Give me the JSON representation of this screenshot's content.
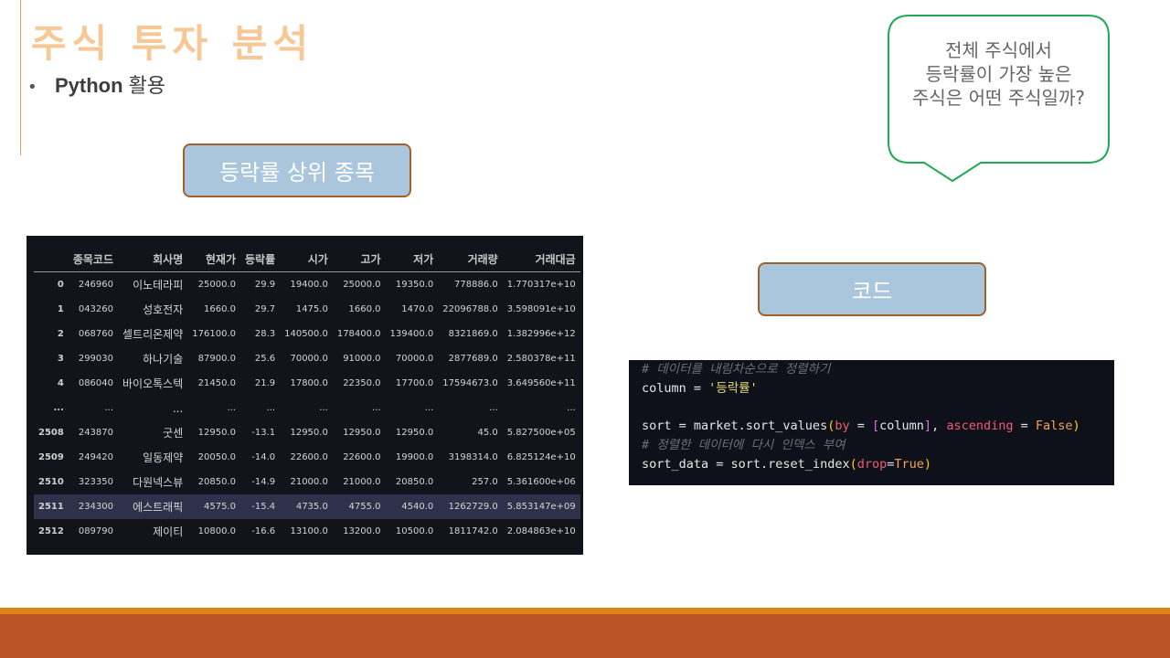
{
  "title": "주식 투자 분석",
  "bullet": {
    "marker": "•",
    "bold": "Python",
    "text": "활용"
  },
  "labels": {
    "top_stocks": "등락률 상위 종목",
    "code": "코드"
  },
  "bubble": {
    "lines": [
      "전체 주식에서",
      "등락률이 가장 높은",
      "주식은 어떤 주식일까?"
    ]
  },
  "table": {
    "columns": [
      "",
      "종목코드",
      "회사명",
      "현재가",
      "등락률",
      "시가",
      "고가",
      "저가",
      "거래량",
      "거래대금"
    ],
    "rows": [
      [
        "0",
        "246960",
        "이노테라피",
        "25000.0",
        "29.9",
        "19400.0",
        "25000.0",
        "19350.0",
        "778886.0",
        "1.770317e+10"
      ],
      [
        "1",
        "043260",
        "성호전자",
        "1660.0",
        "29.7",
        "1475.0",
        "1660.0",
        "1470.0",
        "22096788.0",
        "3.598091e+10"
      ],
      [
        "2",
        "068760",
        "셀트리온제약",
        "176100.0",
        "28.3",
        "140500.0",
        "178400.0",
        "139400.0",
        "8321869.0",
        "1.382996e+12"
      ],
      [
        "3",
        "299030",
        "하나기술",
        "87900.0",
        "25.6",
        "70000.0",
        "91000.0",
        "70000.0",
        "2877689.0",
        "2.580378e+11"
      ],
      [
        "4",
        "086040",
        "바이오톡스텍",
        "21450.0",
        "21.9",
        "17800.0",
        "22350.0",
        "17700.0",
        "17594673.0",
        "3.649560e+11"
      ],
      [
        "...",
        "...",
        "...",
        "...",
        "...",
        "...",
        "...",
        "...",
        "...",
        "..."
      ],
      [
        "2508",
        "243870",
        "굿센",
        "12950.0",
        "-13.1",
        "12950.0",
        "12950.0",
        "12950.0",
        "45.0",
        "5.827500e+05"
      ],
      [
        "2509",
        "249420",
        "일동제약",
        "20050.0",
        "-14.0",
        "22600.0",
        "22600.0",
        "19900.0",
        "3198314.0",
        "6.825124e+10"
      ],
      [
        "2510",
        "323350",
        "다원넥스뷰",
        "20850.0",
        "-14.9",
        "21000.0",
        "21000.0",
        "20850.0",
        "257.0",
        "5.361600e+06"
      ],
      [
        "2511",
        "234300",
        "에스트래픽",
        "4575.0",
        "-15.4",
        "4735.0",
        "4755.0",
        "4540.0",
        "1262729.0",
        "5.853147e+09"
      ],
      [
        "2512",
        "089790",
        "제이티",
        "10800.0",
        "-16.6",
        "13100.0",
        "13200.0",
        "10500.0",
        "1811742.0",
        "2.084863e+10"
      ]
    ]
  },
  "code": {
    "comment1": "# 데이터를 내림차순으로 정렬하기",
    "l2_var": "column",
    "l2_eq": " = ",
    "l2_str": "'등락률'",
    "l4_a": "sort = market.sort_values",
    "l4_p1": "(",
    "l4_by": "by",
    "l4_eq1": " = ",
    "l4_b1": "[",
    "l4_col": "column",
    "l4_b2": "]",
    "l4_comma": ", ",
    "l4_asc": "ascending",
    "l4_eq2": " = ",
    "l4_false": "False",
    "l4_p2": ")",
    "comment2": "# 정렬한 데이터에 다시 인덱스 부여",
    "l6_a": "sort_data = sort.reset_index",
    "l6_p1": "(",
    "l6_drop": "drop",
    "l6_eq": "=",
    "l6_true": "True",
    "l6_p2": ")"
  },
  "colors": {
    "title": "#f5c896",
    "accent_bar": "#df8516",
    "footer_bar": "#bb5528",
    "label_fill": "#a9c6dc",
    "label_border": "#a0622b",
    "bubble_border": "#1faa55"
  }
}
